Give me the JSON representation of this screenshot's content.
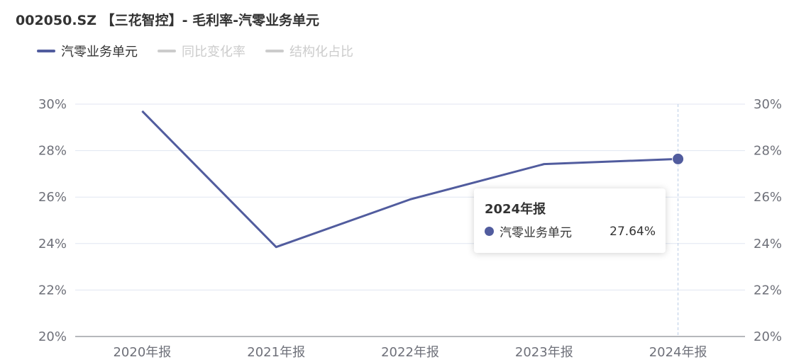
{
  "title": "002050.SZ 【三花智控】- 毛利率-汽零业务单元",
  "legend": [
    {
      "name": "汽零业务单元",
      "color": "#515c9e",
      "active": true
    },
    {
      "name": "同比变化率",
      "color": "#cccccc",
      "active": false
    },
    {
      "name": "结构化占比",
      "color": "#cccccc",
      "active": false
    }
  ],
  "tooltip": {
    "title": "2024年报",
    "series_name": "汽零业务单元",
    "value": "27.64%",
    "color": "#515c9e"
  },
  "chart_data": {
    "type": "line",
    "categories": [
      "2020年报",
      "2021年报",
      "2022年报",
      "2023年报",
      "2024年报"
    ],
    "series": [
      {
        "name": "汽零业务单元",
        "values": [
          29.7,
          23.85,
          25.9,
          27.42,
          27.64
        ],
        "color": "#515c9e"
      }
    ],
    "ylim": [
      20,
      30
    ],
    "y_ticks": [
      20,
      22,
      24,
      26,
      28,
      30
    ],
    "y_tick_labels": [
      "20%",
      "22%",
      "24%",
      "26%",
      "28%",
      "30%"
    ],
    "y_axis_both_sides": true,
    "grid": true,
    "highlighted_category": "2024年报"
  }
}
